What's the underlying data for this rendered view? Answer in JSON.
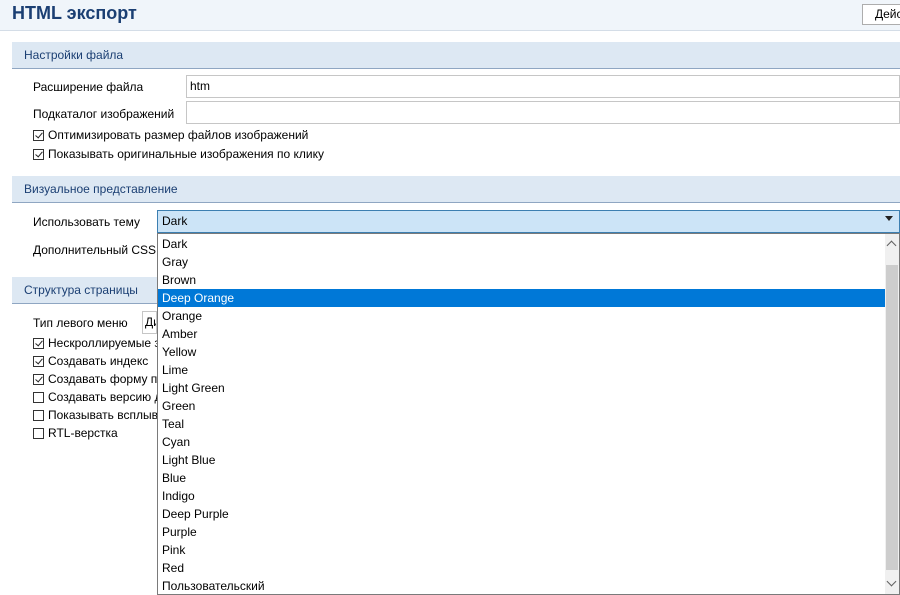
{
  "header": {
    "title": "HTML экспорт",
    "action_label": "Действия"
  },
  "file_settings": {
    "section_title": "Настройки файла",
    "ext_label": "Расширение файла",
    "ext_value": "htm",
    "subdir_label": "Подкаталог изображений",
    "subdir_value": "",
    "optimize_label": "Оптимизировать размер файлов изображений",
    "optimize_checked": true,
    "show_original_label": "Показывать оригинальные изображения по клику",
    "show_original_checked": true
  },
  "visual": {
    "section_title": "Визуальное представление",
    "theme_label": "Использовать тему",
    "theme_value": "Dark",
    "extra_css_label": "Дополнительный CSS"
  },
  "structure": {
    "section_title": "Структура страницы",
    "left_menu_label": "Тип левого меню",
    "left_menu_value": "Ди",
    "options": [
      {
        "label": "Нескроллируемые за",
        "checked": true
      },
      {
        "label": "Создавать индекс",
        "checked": true
      },
      {
        "label": "Создавать форму по",
        "checked": true
      },
      {
        "label": "Создавать версию д",
        "checked": false
      },
      {
        "label": "Показывать всплыва",
        "checked": false
      },
      {
        "label": "RTL-верстка",
        "checked": false
      }
    ]
  },
  "theme_dropdown": {
    "selected_index": 3,
    "items": [
      "Dark",
      "Gray",
      "Brown",
      "Deep Orange",
      "Orange",
      "Amber",
      "Yellow",
      "Lime",
      "Light Green",
      "Green",
      "Teal",
      "Cyan",
      "Light Blue",
      "Blue",
      "Indigo",
      "Deep Purple",
      "Purple",
      "Pink",
      "Red",
      "Пользовательский"
    ]
  },
  "colors": {
    "accent": "#0078d7",
    "section_bg": "#dde8f3",
    "title": "#1b3f73"
  }
}
